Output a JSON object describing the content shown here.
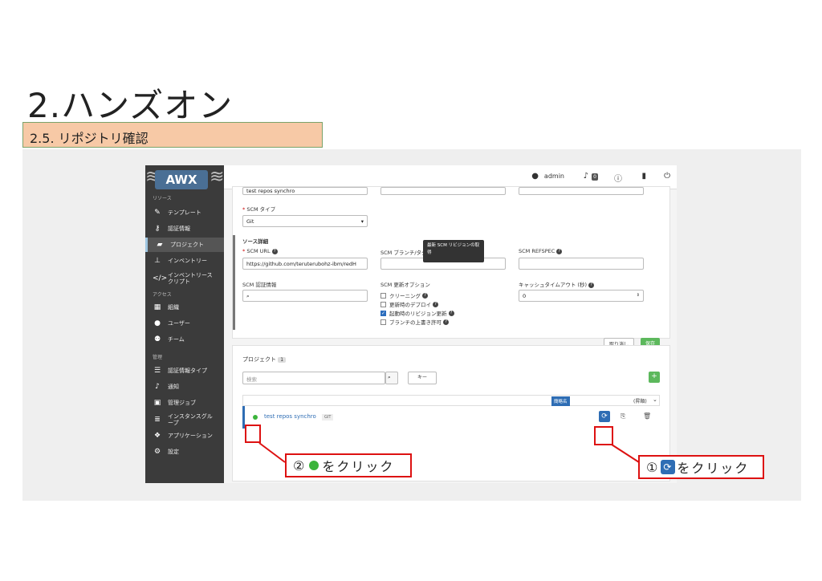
{
  "slide": {
    "title": "2.ハンズオン",
    "section": "2.5. リポジトリ確認"
  },
  "app": {
    "logo": "AWX",
    "user": "admin",
    "notification_count": "0"
  },
  "sidebar": {
    "sections": [
      {
        "label": "リソース"
      },
      {
        "label": "アクセス"
      },
      {
        "label": "管理"
      }
    ],
    "items": [
      {
        "label": "テンプレート",
        "icon": "pencil-square-icon"
      },
      {
        "label": "認証情報",
        "icon": "key-icon"
      },
      {
        "label": "プロジェクト",
        "icon": "folder-open-icon",
        "active": true
      },
      {
        "label": "インベントリー",
        "icon": "sitemap-icon"
      },
      {
        "label": "インベントリースクリプト",
        "icon": "code-icon"
      },
      {
        "label": "組織",
        "icon": "building-icon"
      },
      {
        "label": "ユーザー",
        "icon": "user-icon"
      },
      {
        "label": "チーム",
        "icon": "users-icon"
      },
      {
        "label": "認証情報タイプ",
        "icon": "list-alt-icon"
      },
      {
        "label": "通知",
        "icon": "bell-icon"
      },
      {
        "label": "管理ジョブ",
        "icon": "briefcase-icon"
      },
      {
        "label": "インスタンスグループ",
        "icon": "server-icon"
      },
      {
        "label": "アプリケーション",
        "icon": "cubes-icon"
      },
      {
        "label": "設定",
        "icon": "cog-icon"
      }
    ]
  },
  "form": {
    "name_value": "test repos synchro",
    "scm_type_label": "SCM タイプ",
    "scm_type_value": "Git",
    "source_details_label": "ソース詳細",
    "scm_url_label": "SCM URL",
    "scm_url_value": "https://github.com/teruterubohz-ibm/redH",
    "branch_label": "SCM ブランチ/タグ/コミット",
    "refspec_label": "SCM REFSPEC",
    "credential_label": "SCM 認証情報",
    "update_options_label": "SCM 更新オプション",
    "options": [
      {
        "label": "クリーニング",
        "checked": false
      },
      {
        "label": "更新時のデプロイ",
        "checked": false
      },
      {
        "label": "起動時のリビジョン更新",
        "checked": true
      },
      {
        "label": "ブランチの上書き許可",
        "checked": false
      }
    ],
    "cache_timeout_label": "キャッシュタイムアウト (秒)",
    "cache_timeout_value": "0",
    "cancel_label": "取り消し",
    "save_label": "保存"
  },
  "project_list": {
    "title": "プロジェクト",
    "count": "1",
    "search_placeholder": "検索",
    "key_button": "キー",
    "add_button": "+",
    "sort_label": "簡略名",
    "sort_order": "(昇順)",
    "row": {
      "name": "test repos synchro",
      "type_badge": "GIT",
      "status_color": "#3cb43c"
    },
    "tooltip": "最新 SCM リビジョンの取得"
  },
  "callouts": {
    "one_num": "①",
    "one_text": "をクリック",
    "two_num": "②",
    "two_text": "をクリック"
  }
}
